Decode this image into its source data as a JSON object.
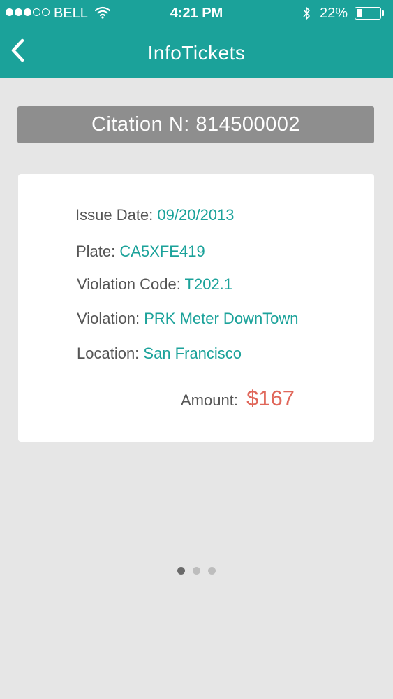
{
  "status_bar": {
    "signal": {
      "filled": 3,
      "total": 5
    },
    "carrier": "BELL",
    "time": "4:21 PM",
    "battery_percent": "22%",
    "battery_level": 0.22,
    "icons": [
      "wifi-icon",
      "bluetooth-icon",
      "battery-icon"
    ]
  },
  "nav": {
    "title": "InfoTickets",
    "back_icon": "chevron-left-icon"
  },
  "citation": {
    "label": "Citation N: 814500002"
  },
  "details": {
    "issue_date_label": "Issue Date:",
    "issue_date": "09/20/2013",
    "plate_label": "Plate:",
    "plate": "CA5XFE419",
    "violation_code_label": "Violation Code:",
    "violation_code": "T202.1",
    "violation_label": "Violation:",
    "violation": "PRK Meter DownTown",
    "location_label": "Location:",
    "location": "San Francisco",
    "amount_label": "Amount:",
    "amount": "$167"
  },
  "pager": {
    "count": 3,
    "active_index": 0
  },
  "colors": {
    "accent": "#1ba29a",
    "amount": "#e0675a",
    "citation_bg": "#8e8e8e",
    "background": "#e6e6e6"
  }
}
